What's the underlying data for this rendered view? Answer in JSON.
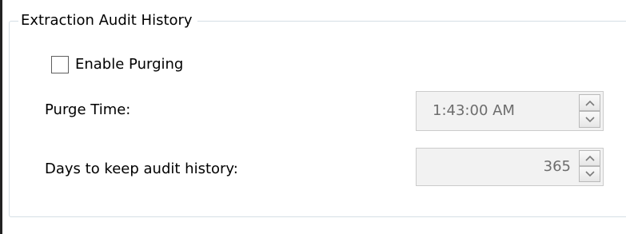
{
  "group": {
    "title": "Extraction Audit History"
  },
  "enable_purging": {
    "label": "Enable Purging",
    "checked": false
  },
  "purge_time": {
    "label": "Purge Time:",
    "value": "1:43:00 AM"
  },
  "days_to_keep": {
    "label": "Days to keep audit history:",
    "value": "365"
  },
  "icons": {
    "up": "chevron-up-icon",
    "down": "chevron-down-icon"
  },
  "colors": {
    "group_border": "#d5dfe5",
    "disabled_field_bg": "#f2f2f2",
    "disabled_text": "#6d6d6d"
  }
}
